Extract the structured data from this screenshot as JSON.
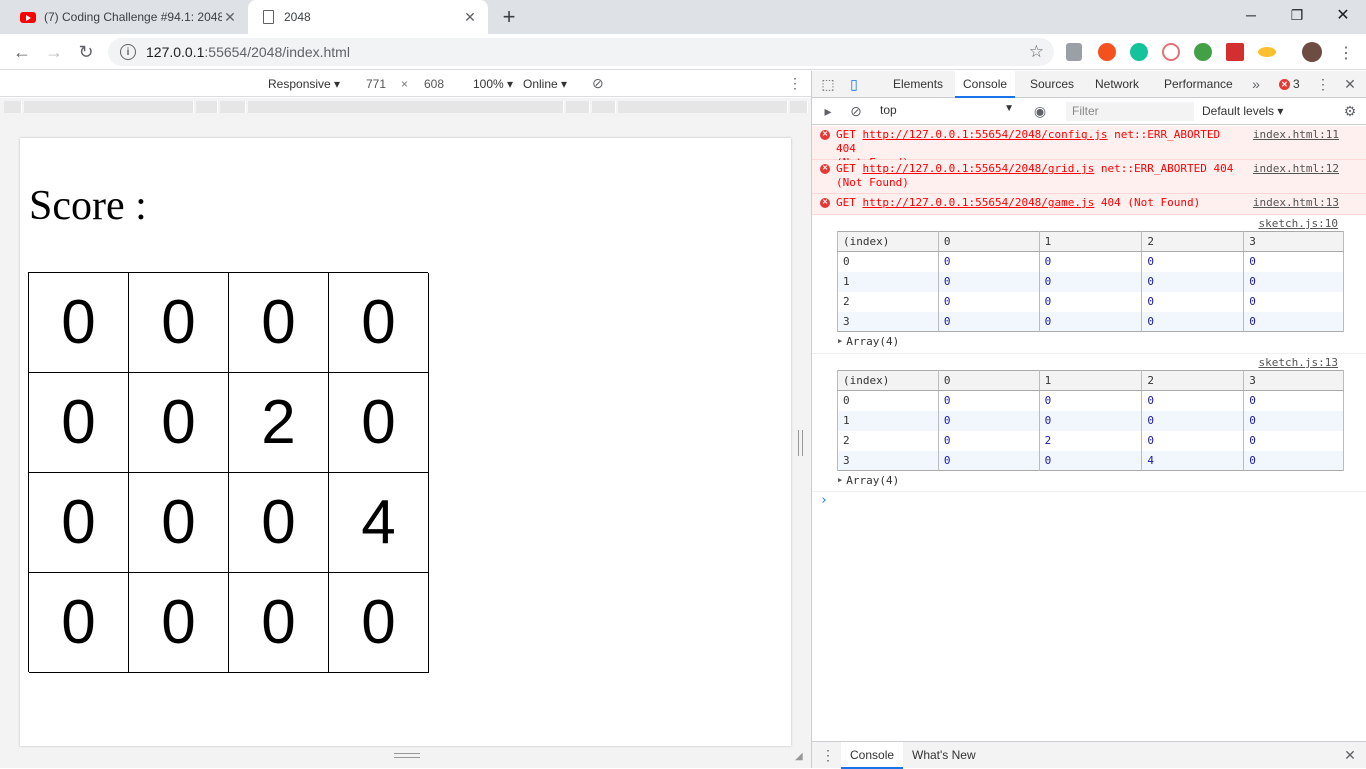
{
  "browser": {
    "tabs": [
      {
        "title": "(7) Coding Challenge #94.1: 2048",
        "icon": "youtube-icon"
      },
      {
        "title": "2048",
        "icon": "document-icon"
      }
    ],
    "url_host": "127.0.0.1",
    "url_path": ":55654/2048/index.html"
  },
  "device_toolbar": {
    "mode": "Responsive",
    "width": "771",
    "times": "×",
    "height": "608",
    "zoom": "100%",
    "network": "Online"
  },
  "page": {
    "score_label": "Score :",
    "grid": [
      [
        "0",
        "0",
        "0",
        "0"
      ],
      [
        "0",
        "0",
        "2",
        "0"
      ],
      [
        "0",
        "0",
        "0",
        "4"
      ],
      [
        "0",
        "0",
        "0",
        "0"
      ]
    ]
  },
  "devtools": {
    "tabs": [
      "Elements",
      "Console",
      "Sources",
      "Network",
      "Performance"
    ],
    "active_tab": "Console",
    "more": "»",
    "error_count": "3",
    "context": "top",
    "filter_placeholder": "Filter",
    "levels": "Default levels",
    "errors": [
      {
        "method": "GET",
        "url": "http://127.0.0.1:55654/2048/config.js",
        "status": "net::ERR_ABORTED 404",
        "detail": "(Not Found)",
        "source": "index.html:11"
      },
      {
        "method": "GET",
        "url": "http://127.0.0.1:55654/2048/grid.js",
        "status": "net::ERR_ABORTED 404",
        "detail": "(Not Found)",
        "source": "index.html:12"
      },
      {
        "method": "GET",
        "url": "http://127.0.0.1:55654/2048/game.js",
        "status": "404 (Not Found)",
        "detail": "",
        "source": "index.html:13"
      }
    ],
    "logs": [
      {
        "source": "sketch.js:10",
        "headers": [
          "(index)",
          "0",
          "1",
          "2",
          "3"
        ],
        "rows": [
          [
            "0",
            "0",
            "0",
            "0",
            "0"
          ],
          [
            "1",
            "0",
            "0",
            "0",
            "0"
          ],
          [
            "2",
            "0",
            "0",
            "0",
            "0"
          ],
          [
            "3",
            "0",
            "0",
            "0",
            "0"
          ]
        ],
        "footer": "Array(4)"
      },
      {
        "source": "sketch.js:13",
        "headers": [
          "(index)",
          "0",
          "1",
          "2",
          "3"
        ],
        "rows": [
          [
            "0",
            "0",
            "0",
            "0",
            "0"
          ],
          [
            "1",
            "0",
            "0",
            "0",
            "0"
          ],
          [
            "2",
            "0",
            "2",
            "0",
            "0"
          ],
          [
            "3",
            "0",
            "0",
            "4",
            "0"
          ]
        ],
        "footer": "Array(4)"
      }
    ],
    "drawer_tabs": [
      "Console",
      "What's New"
    ]
  }
}
